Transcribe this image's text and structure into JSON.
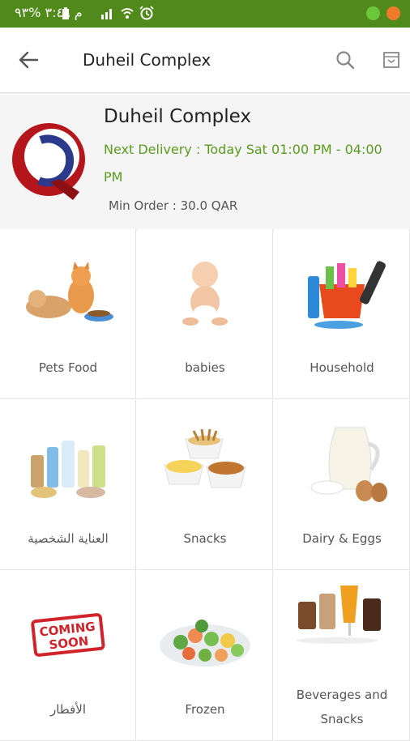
{
  "status_bar": {
    "text": "م ٣:٤٩  %٩٣",
    "background": "#4f8a1b"
  },
  "app_bar": {
    "title": "Duheil Complex"
  },
  "store": {
    "name": "Duheil Complex",
    "delivery_line1": "Next Delivery  : Today  Sat 01:00 PM - 04:00",
    "delivery_line2": "PM",
    "min_order": "Min Order  : 30.0 QAR",
    "accent": "#5a9b1d"
  },
  "categories": [
    {
      "label": "Pets Food",
      "icon": "pets-food-image"
    },
    {
      "label": "babies",
      "icon": "baby-image"
    },
    {
      "label": "Household",
      "icon": "household-cleaning-image"
    },
    {
      "label": "العناية الشخصية",
      "icon": "personal-care-image"
    },
    {
      "label": "Snacks",
      "icon": "snacks-image"
    },
    {
      "label": "Dairy & Eggs",
      "icon": "dairy-eggs-image"
    },
    {
      "label": "الأفطار",
      "icon": "coming-soon-stamp"
    },
    {
      "label": "Frozen",
      "icon": "frozen-vegetables-image"
    },
    {
      "label": "Beverages and Snacks",
      "icon": "beverages-image"
    }
  ],
  "coming_soon": {
    "line1": "COMING",
    "line2": "SOON"
  }
}
